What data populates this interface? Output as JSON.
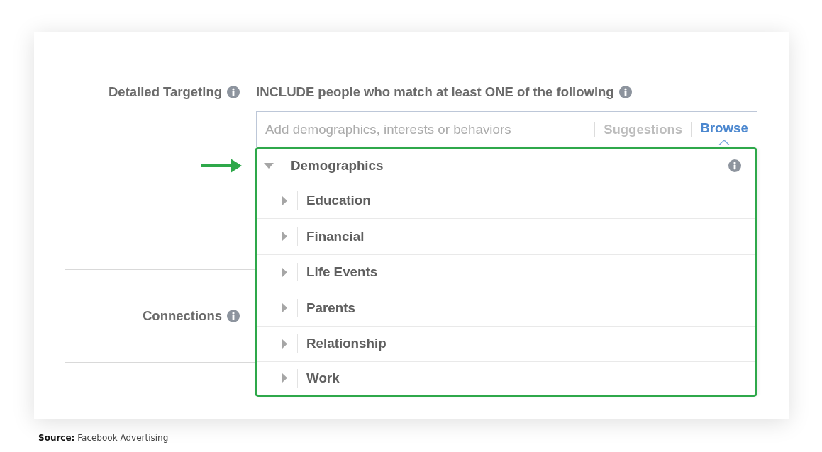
{
  "detailed_targeting": {
    "label": "Detailed Targeting",
    "heading": "INCLUDE people who match at least ONE of the following",
    "search": {
      "placeholder": "Add demographics, interests or behaviors"
    },
    "tabs": [
      {
        "label": "Suggestions",
        "selected": false
      },
      {
        "label": "Browse",
        "selected": true
      }
    ],
    "tree": [
      {
        "label": "Demographics",
        "expanded": true,
        "children": [
          {
            "label": "Education",
            "expanded": false
          },
          {
            "label": "Financial",
            "expanded": false
          },
          {
            "label": "Life Events",
            "expanded": false
          },
          {
            "label": "Parents",
            "expanded": false
          },
          {
            "label": "Relationship",
            "expanded": false
          },
          {
            "label": "Work",
            "expanded": false
          }
        ]
      }
    ]
  },
  "connections": {
    "label": "Connections"
  },
  "source": "**Source:** Facebook Advertising"
}
